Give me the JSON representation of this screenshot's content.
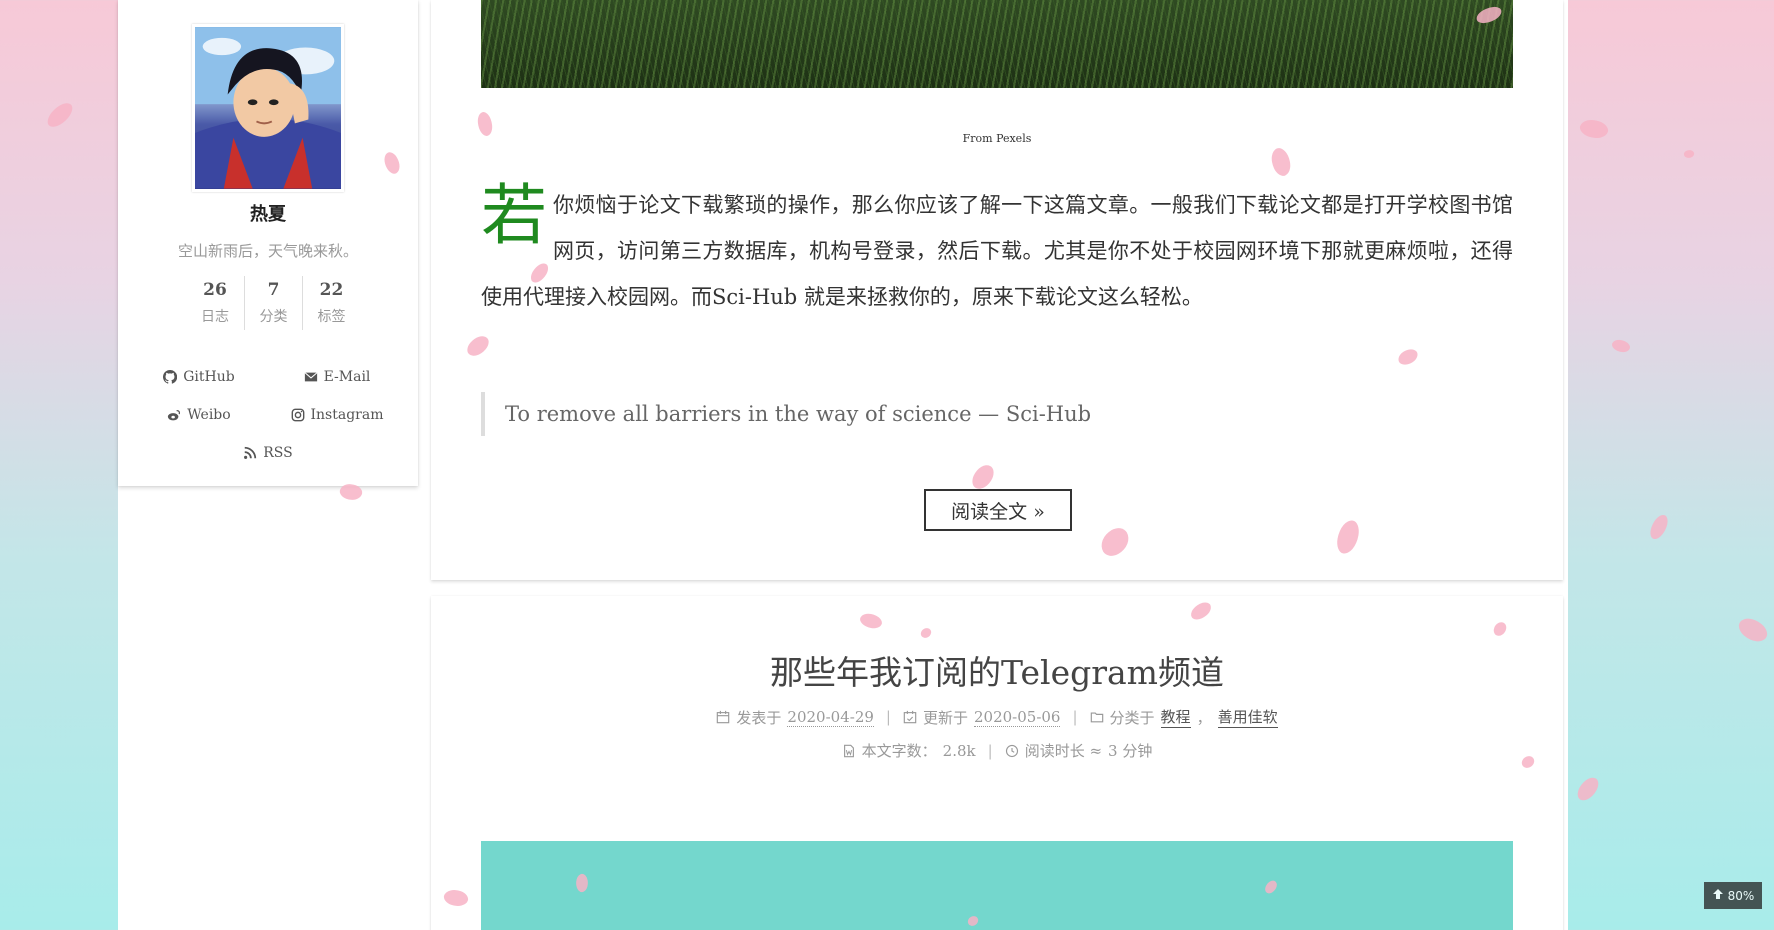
{
  "sidebar": {
    "author": "热夏",
    "description": "空山新雨后，天气晚来秋。",
    "stats": [
      {
        "count": "26",
        "label": "日志"
      },
      {
        "count": "7",
        "label": "分类"
      },
      {
        "count": "22",
        "label": "标签"
      }
    ],
    "links": [
      {
        "label": "GitHub",
        "icon": "github-icon"
      },
      {
        "label": "E-Mail",
        "icon": "envelope-icon"
      },
      {
        "label": "Weibo",
        "icon": "weibo-icon"
      },
      {
        "label": "Instagram",
        "icon": "instagram-icon"
      },
      {
        "label": "RSS",
        "icon": "rss-icon"
      }
    ]
  },
  "post1": {
    "image_caption": "From Pexels",
    "dropcap": "若",
    "excerpt": "你烦恼于论文下载繁琐的操作，那么你应该了解一下这篇文章。一般我们下载论文都是打开学校图书馆网页，访问第三方数据库，机构号登录，然后下载。尤其是你不处于校园网环境下那就更麻烦啦，还得使用代理接入校园网。而Sci-Hub 就是来拯救你的，原来下载论文这么轻松。",
    "quote": "To remove all barriers in the way of science — Sci-Hub",
    "read_more": "阅读全文 »"
  },
  "post2": {
    "title": "那些年我订阅的Telegram频道",
    "posted_label": "发表于",
    "posted_date": "2020-04-29",
    "updated_label": "更新于",
    "updated_date": "2020-05-06",
    "category_label": "分类于",
    "categories": [
      "教程",
      "善用佳软"
    ],
    "category_sep": "，",
    "wordcount_label": "本文字数：",
    "wordcount": "2.8k",
    "readtime_label": "阅读时长 ≈",
    "readtime": "3 分钟"
  },
  "back_to_top": {
    "percent": "80%",
    "icon": "arrow-up-icon"
  },
  "colors": {
    "dropcap": "#1f8a1f",
    "hero_teal": "#74d7cd",
    "petal": "#f7b3c6"
  }
}
